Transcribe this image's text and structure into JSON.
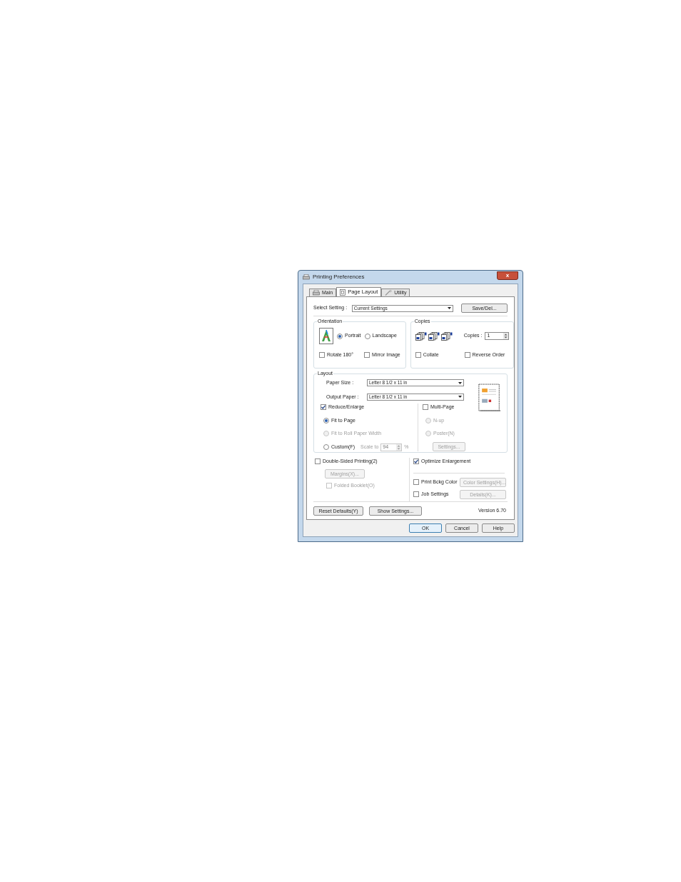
{
  "window": {
    "title": "Printing Preferences",
    "close": "x"
  },
  "tabs": [
    {
      "label": "Main",
      "selected": false,
      "kind": "printer"
    },
    {
      "label": "Page Layout",
      "selected": true,
      "kind": "page"
    },
    {
      "label": "Utility",
      "selected": false,
      "kind": "wrench"
    }
  ],
  "select_setting": {
    "label": "Select Setting :",
    "value": "Current Settings"
  },
  "save_del_button": "Save/Del...",
  "orientation": {
    "title": "Orientation",
    "options": [
      {
        "label": "Portrait",
        "selected": true
      },
      {
        "label": "Landscape",
        "selected": false
      }
    ],
    "checkboxes": [
      {
        "label": "Rotate 180°",
        "checked": false
      },
      {
        "label": "Mirror Image",
        "checked": false
      }
    ]
  },
  "copies": {
    "title": "Copies",
    "label": "Copies :",
    "value": "1",
    "checkboxes": [
      {
        "label": "Collate",
        "checked": false
      },
      {
        "label": "Reverse Order",
        "checked": false
      }
    ]
  },
  "layout": {
    "title": "Layout",
    "paper_size": {
      "label": "Paper Size :",
      "value": "Letter 8 1/2 x 11 in"
    },
    "output_paper": {
      "label": "Output Paper :",
      "value": "Letter 8 1/2 x 11 in"
    },
    "reduce_enlarge": {
      "label": "Reduce/Enlarge",
      "checked": true
    },
    "options": [
      {
        "label": "Fit to Page",
        "selected": true,
        "disabled": false
      },
      {
        "label": "Fit to Roll Paper Width",
        "selected": false,
        "disabled": true
      },
      {
        "label": "Custom(F)",
        "selected": false,
        "disabled": false
      }
    ],
    "scale": {
      "label": "Scale to",
      "value": "94",
      "unit": "%",
      "disabled": true
    },
    "multi_page": {
      "label": "Multi-Page",
      "checked": false
    },
    "multi_options": [
      {
        "label": "N-up",
        "selected": false,
        "disabled": true
      },
      {
        "label": "Poster(N)",
        "selected": false,
        "disabled": true
      }
    ],
    "settings_button": {
      "label": "Settings...",
      "disabled": true
    }
  },
  "double_sided": {
    "label": "Double-Sided Printing(2)",
    "checked": false
  },
  "margins_button": {
    "label": "Margins(X)...",
    "disabled": true
  },
  "folded_booklet": {
    "label": "Folded Booklet(O)",
    "checked": false,
    "disabled": true
  },
  "optimize_enlargement": {
    "label": "Optimize Enlargement",
    "checked": true
  },
  "print_bkg_color": {
    "label": "Print Bckg Color",
    "checked": false
  },
  "color_settings_button": {
    "label": "Color Settings(H)...",
    "disabled": true
  },
  "job_settings": {
    "label": "Job Settings",
    "checked": false
  },
  "details_button": {
    "label": "Details(K)...",
    "disabled": true
  },
  "footer_buttons": [
    "Reset Defaults(Y)",
    "Show Settings..."
  ],
  "version": "Version 6.70",
  "dialog_buttons": [
    {
      "label": "OK",
      "default": true
    },
    {
      "label": "Cancel",
      "default": false
    },
    {
      "label": "Help",
      "default": false
    }
  ]
}
